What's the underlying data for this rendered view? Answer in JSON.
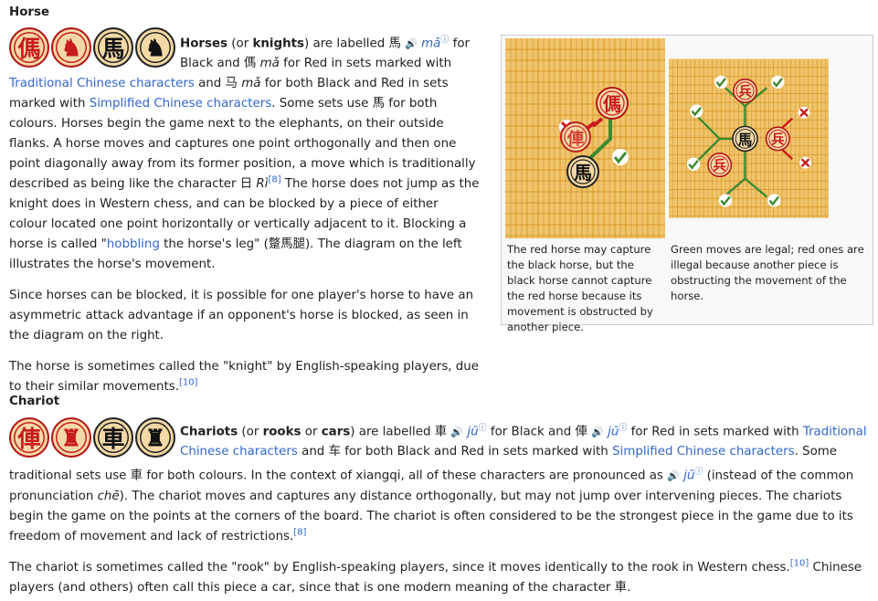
{
  "horse": {
    "heading": "Horse",
    "icons": [
      {
        "name": "red-horse-traditional-icon",
        "char": "傌",
        "color": "red"
      },
      {
        "name": "red-horse-icon",
        "char": "♞",
        "color": "red"
      },
      {
        "name": "black-horse-traditional-icon",
        "char": "馬",
        "color": "black"
      },
      {
        "name": "black-horse-icon",
        "char": "♞",
        "color": "black"
      }
    ],
    "p1": {
      "b1": "Horses",
      "t1": " (or ",
      "b2": "knights",
      "t2": ") are labelled 馬 ",
      "spk": "🔊",
      "pron1": "mǎ",
      "info": "ⓘ",
      "t3": " for Black and 傌 ",
      "pron2": "mǎ",
      "t4": " for Red in sets marked with ",
      "link1": "Traditional Chinese characters",
      "t5": " and 马 ",
      "pron3": "mǎ",
      "t6": " for both Black and Red in sets marked with ",
      "link2": "Simplified Chinese characters",
      "t7": ". Some sets use 馬 for both colours. Horses begin the game next to the elephants, on their outside flanks. A horse moves and captures one point orthogonally and then one point diagonally away from its former position, a move which is traditionally described as being like the character 日 ",
      "pron4": "Rì",
      "ref": "[8]",
      "t8": " The horse does not jump as the knight does in Western chess, and can be blocked by a piece of either colour located one point horizontally or vertically adjacent to it. Blocking a horse is called \"",
      "link3": "hobbling",
      "t9": " the horse's leg\" (蹩馬腿). The diagram on the left illustrates the horse's movement."
    },
    "p2": "Since horses can be blocked, it is possible for one player's horse to have an asymmetric attack advantage if an opponent's horse is blocked, as seen in the diagram on the right.",
    "p3": {
      "text": "The horse is sometimes called the \"knight\" by English-speaking players, due to their similar movements.",
      "ref": "[10]"
    },
    "figure": {
      "left_board": {
        "pieces": [
          "傌",
          "俥",
          "馬"
        ]
      },
      "right_board": {
        "pieces": [
          "馬",
          "兵",
          "兵",
          "兵"
        ]
      },
      "caption_left": "The red horse may capture the black horse, but the black horse cannot capture the red horse because its movement is obstructed by another piece.",
      "caption_right": "Green moves are legal; red ones are illegal because another piece is obstructing the movement of the horse.",
      "colors": {
        "board": "#f0c46a",
        "grid": "#d99a2b",
        "legal": "#3f8a2f",
        "illegal": "#cc1b1b"
      }
    }
  },
  "chariot": {
    "heading": "Chariot",
    "icons": [
      {
        "name": "red-chariot-traditional-icon",
        "char": "俥",
        "color": "red"
      },
      {
        "name": "red-chariot-icon",
        "char": "♜",
        "color": "red"
      },
      {
        "name": "black-chariot-traditional-icon",
        "char": "車",
        "color": "black"
      },
      {
        "name": "black-chariot-icon",
        "char": "♜",
        "color": "black"
      }
    ],
    "p1": {
      "b1": "Chariots",
      "t1": " (or ",
      "b2": "rooks",
      "t2": " or ",
      "b3": "cars",
      "t3": ") are labelled 車 ",
      "spk": "🔊",
      "pron1": "jū",
      "info": "ⓘ",
      "t4": " for Black and 俥 ",
      "pron2": "jū",
      "t5": " for Red in sets marked with ",
      "link1": "Traditional Chinese characters",
      "t6": " and 车 for both Black and Red in sets marked with ",
      "link2": "Simplified Chinese characters",
      "t7": ". Some traditional sets use 車 for both colours. In the context of xiangqi, all of these characters are pronounced as ",
      "pron3": "jū",
      "t8": " (instead of the common pronunciation ",
      "pron4": "chē",
      "t9": "). The chariot moves and captures any distance orthogonally, but may not jump over intervening pieces. The chariots begin the game on the points at the corners of the board. The chariot is often considered to be the strongest piece in the game due to its freedom of movement and lack of restrictions.",
      "ref": "[8]"
    },
    "p2": {
      "t1": "The chariot is sometimes called the \"rook\" by English-speaking players, since it moves identically to the rook in Western chess.",
      "ref": "[10]",
      "t2": " Chinese players (and others) often call this piece a car, since that is one modern meaning of the character 車."
    }
  }
}
